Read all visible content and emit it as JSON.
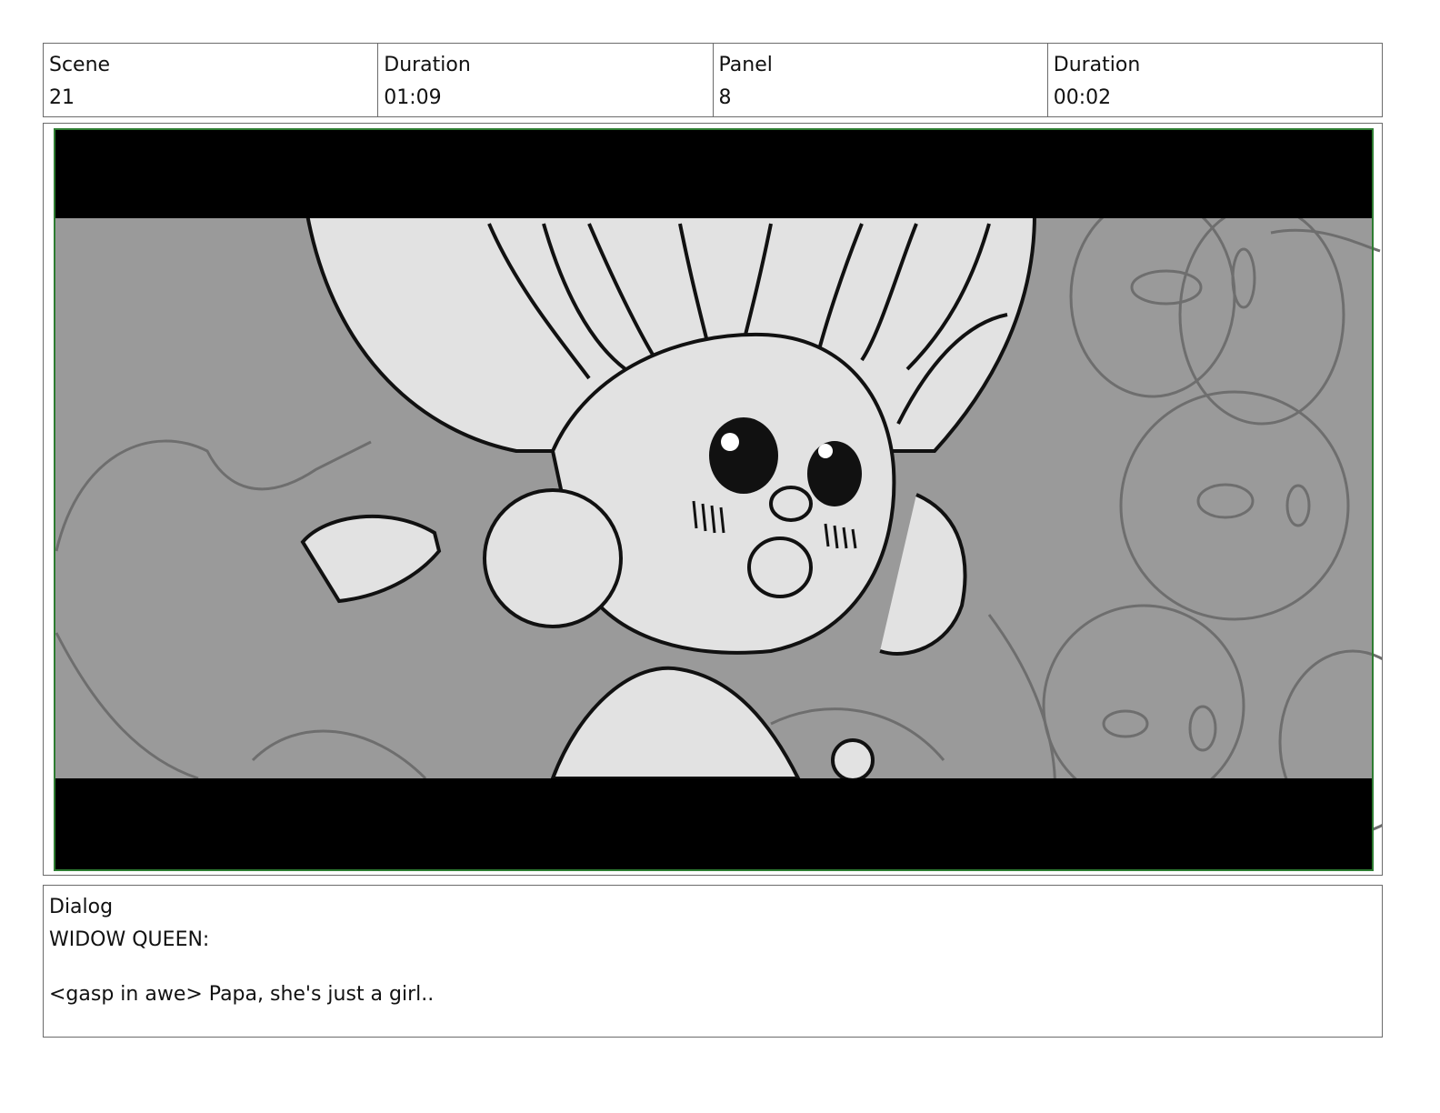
{
  "header": {
    "scene_label": "Scene",
    "scene_value": "21",
    "scene_duration_label": "Duration",
    "scene_duration_value": "01:09",
    "panel_label": "Panel",
    "panel_value": "8",
    "panel_duration_label": "Duration",
    "panel_duration_value": "00:02"
  },
  "panel_image": {
    "description_icon": "storyboard-sketch-icon",
    "colors": {
      "letterbox": "#000000",
      "background": "#9a9a9a",
      "character": "#e2e2e2",
      "frame_border": "#2e7d32"
    }
  },
  "dialog": {
    "label": "Dialog",
    "speaker": "WIDOW QUEEN:",
    "text": "<gasp in awe> Papa, she's just a girl.."
  }
}
